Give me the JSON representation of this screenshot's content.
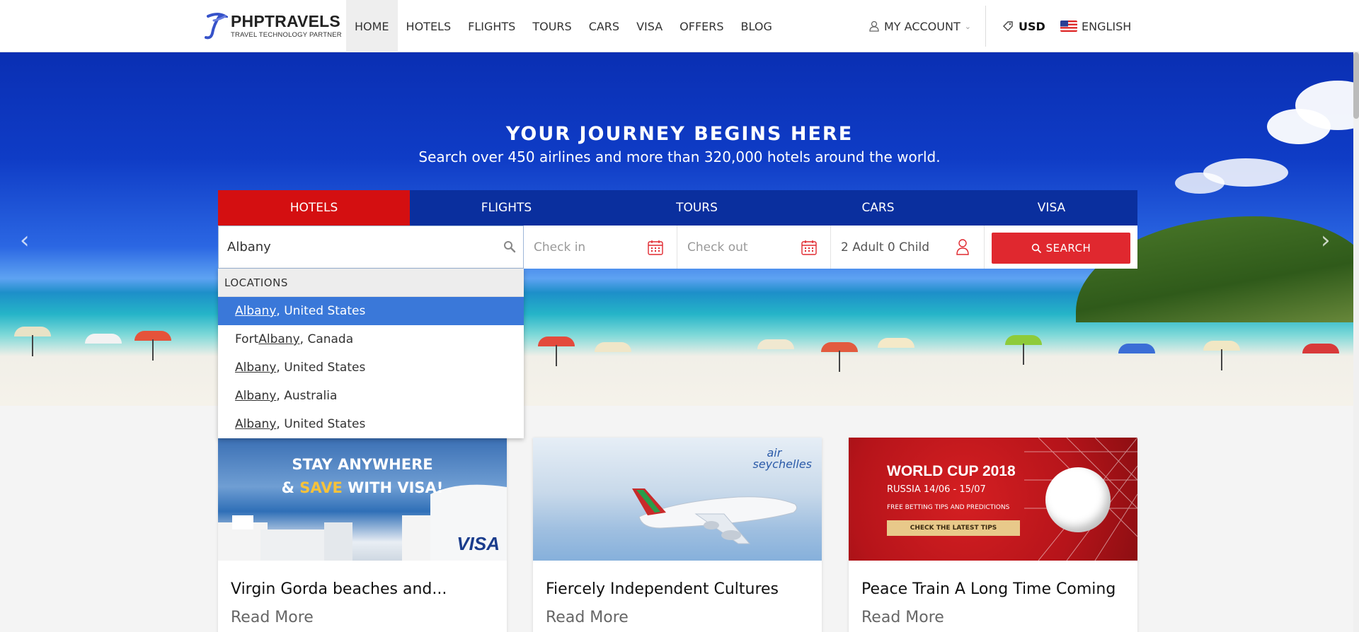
{
  "brand": {
    "name": "PHPTRAVELS",
    "tagline": "TRAVEL TECHNOLOGY PARTNER",
    "accent": "#d40f11",
    "nav_blue": "#0a2f9e",
    "highlight_blue": "#3a78d9"
  },
  "nav": {
    "items": [
      {
        "label": "HOME",
        "active": true
      },
      {
        "label": "HOTELS"
      },
      {
        "label": "FLIGHTS"
      },
      {
        "label": "TOURS"
      },
      {
        "label": "CARS"
      },
      {
        "label": "VISA"
      },
      {
        "label": "OFFERS"
      },
      {
        "label": "BLOG"
      }
    ],
    "account_label": "MY ACCOUNT",
    "currency": "USD",
    "language": "ENGLISH"
  },
  "hero": {
    "title": "YOUR JOURNEY BEGINS HERE",
    "subtitle": "Search over 450 airlines and more than 320,000 hotels around the world."
  },
  "search": {
    "tabs": [
      {
        "label": "HOTELS",
        "active": true
      },
      {
        "label": "FLIGHTS"
      },
      {
        "label": "TOURS"
      },
      {
        "label": "CARS"
      },
      {
        "label": "VISA"
      }
    ],
    "location_value": "Albany",
    "checkin_placeholder": "Check in",
    "checkout_placeholder": "Check out",
    "guests": "2 Adult 0 Child",
    "button_label": "SEARCH"
  },
  "autocomplete": {
    "header": "LOCATIONS",
    "items": [
      {
        "prefix": "",
        "match": "Albany",
        "suffix": ", United States",
        "selected": true
      },
      {
        "prefix": "Fort ",
        "match": "Albany",
        "suffix": ", Canada"
      },
      {
        "prefix": "",
        "match": "Albany",
        "suffix": ", United States"
      },
      {
        "prefix": "",
        "match": "Albany",
        "suffix": ", Australia"
      },
      {
        "prefix": "",
        "match": "Albany",
        "suffix": ", United States"
      }
    ]
  },
  "cards": [
    {
      "title": "Virgin Gorda beaches and...",
      "read_more": "Read More",
      "banner": {
        "line1": "STAY ANYWHERE",
        "line2_a": "& ",
        "line2_hl": "SAVE",
        "line2_b": " WITH VISA!",
        "logo": "VISA"
      }
    },
    {
      "title": "Fiercely Independent Cultures",
      "read_more": "Read More",
      "banner": {
        "logo_line1": "air",
        "logo_line2": "seychelles"
      }
    },
    {
      "title": "Peace Train A Long Time Coming",
      "read_more": "Read More",
      "banner": {
        "title": "WORLD CUP 2018",
        "sub": "RUSSIA 14/06 - 15/07",
        "tip": "FREE BETTING TIPS AND PREDICTIONS",
        "button": "CHECK THE LATEST TIPS"
      }
    }
  ]
}
